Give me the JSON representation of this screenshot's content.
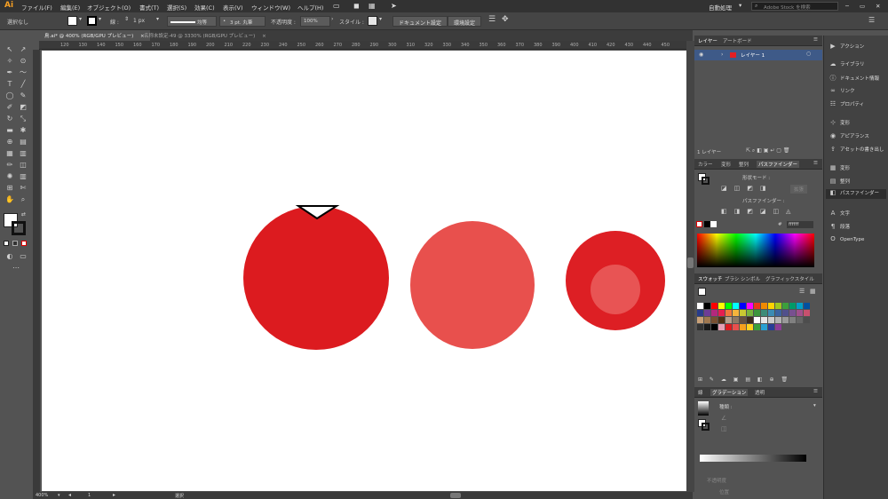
{
  "app": {
    "logo": "Ai",
    "accent": "#f7a024"
  },
  "menu": [
    "ファイル(F)",
    "編集(E)",
    "オブジェクト(O)",
    "書式(T)",
    "選択(S)",
    "効果(C)",
    "表示(V)",
    "ウィンドウ(W)",
    "ヘルプ(H)"
  ],
  "menubar_right": {
    "workspace": "自動処理",
    "search_placeholder": "Adobe Stock を検索"
  },
  "control": {
    "selection": "選択なし",
    "stroke_label": "線 :",
    "stroke_value": "1 px",
    "stroke_profile": "均等",
    "brush": "3 pt. 丸筆",
    "opacity_label": "不透明度 :",
    "opacity_value": "100%",
    "style_label": "スタイル :",
    "doc_setup": "ドキュメント設定",
    "prefs": "環境設定"
  },
  "tabs": [
    {
      "label": "鳥.ai* @ 400% (RGB/GPU プレビュー)",
      "close": "×"
    },
    {
      "label": "名称未設定-49 @ 3330% (RGB/GPU プレビュー)",
      "close": "×"
    }
  ],
  "ruler_ticks": [
    "120",
    "130",
    "140",
    "150",
    "160",
    "170",
    "180",
    "190",
    "200",
    "210",
    "220",
    "230",
    "240",
    "250",
    "260",
    "270",
    "280",
    "290",
    "300",
    "310",
    "320",
    "330",
    "340",
    "350",
    "360",
    "370",
    "380",
    "390",
    "400",
    "410",
    "420",
    "430",
    "440",
    "450"
  ],
  "status": {
    "zoom": "400%",
    "page": "1",
    "mode": "選択"
  },
  "layers_panel": {
    "tabs": [
      "レイヤー",
      "アートボード"
    ],
    "layer_name": "レイヤー 1",
    "count": "1 レイヤー"
  },
  "pathfinder_panel": {
    "tabs": [
      "カラー",
      "変形",
      "整列",
      "パスファインダー"
    ],
    "shape_modes": "形状モード :",
    "expand": "拡張",
    "pathfinders": "パスファインダー :",
    "hex": "ffffff"
  },
  "swatch_panel": {
    "tabs": [
      "スウォッチ",
      "ブラシ",
      "シンボル",
      "グラフィックスタイル"
    ]
  },
  "gradient_panel": {
    "tabs": [
      "線",
      "グラデーション",
      "透明"
    ],
    "type_label": "種類 :",
    "opacity_label": "不透明度",
    "position_label": "位置"
  },
  "dock": [
    "アクション",
    "ライブラリ",
    "ドキュメント情報",
    "リンク",
    "プロパティ",
    "変形",
    "アピアランス",
    "アセットの書き出し",
    "変形",
    "整列",
    "パスファインダー",
    "文字",
    "段落",
    "OpenType"
  ],
  "colors": {
    "circle_big": "#dc1b1f",
    "circle_mid": "#e8504d",
    "circle_outer": "#dd1f24",
    "circle_inner": "#e85454"
  },
  "swatches": [
    "#ffffff",
    "#000000",
    "#ff0000",
    "#ffff00",
    "#00ff00",
    "#00ffff",
    "#0000ff",
    "#ff00ff",
    "#e8371a",
    "#f08a00",
    "#ffd300",
    "#a0c81e",
    "#3ca03c",
    "#009a68",
    "#00a0c8",
    "#0050a0",
    "#283c8c",
    "#6e3c96",
    "#b4287d",
    "#e61e50",
    "#f0783c",
    "#f5b43c",
    "#c8c832",
    "#78b43c",
    "#3c963c",
    "#3c8c78",
    "#3c8cb4",
    "#3c64a0",
    "#50508c",
    "#785090",
    "#a0508c",
    "#c8506e",
    "#c8a078",
    "#a07850",
    "#785032",
    "#503214",
    "#b4a08c",
    "#8c7864",
    "#645040",
    "#3c2c1e",
    "#ffffff",
    "#e6e6e6",
    "#cccccc",
    "#b3b3b3",
    "#999999",
    "#808080",
    "#666666",
    "#4d4d4d",
    "#333333",
    "#1a1a1a",
    "#000000",
    "#e6a0b4",
    "#dc1b1f",
    "#e8504d",
    "#f5a01e",
    "#ffd21e",
    "#3ca03c",
    "#28a0d2",
    "#283c96",
    "#8c3c96"
  ]
}
